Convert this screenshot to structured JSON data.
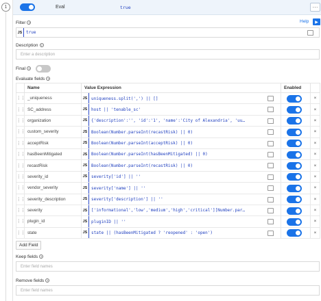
{
  "step": {
    "number": "1"
  },
  "header": {
    "rule_name": "Eval",
    "condition": "true",
    "enabled": true,
    "more_label": "···"
  },
  "filter": {
    "label": "Filter",
    "help_label": "Help",
    "lang": "JS",
    "code": "true"
  },
  "description": {
    "label": "Description",
    "placeholder": "Enter a description"
  },
  "final": {
    "label": "Final",
    "enabled": false
  },
  "evaluate": {
    "label": "Evaluate fields",
    "col_name": "Name",
    "col_expression": "Value Expression",
    "col_enabled": "Enabled",
    "rows": [
      {
        "name": "_uniqueness",
        "lang": "JS",
        "expr": "uniqueness.split(',') || []",
        "enabled": true
      },
      {
        "name": "SC_address",
        "lang": "JS",
        "expr": "host || 'tenable_sc'",
        "enabled": true
      },
      {
        "name": "organization",
        "lang": "JS",
        "expr": "{'description':'', 'id':'1', 'name':'City of Alexandria', 'uu…",
        "enabled": true
      },
      {
        "name": "custom_severity",
        "lang": "JS",
        "expr": "Boolean(Number.parseInt(recastRisk) || 0)",
        "enabled": true
      },
      {
        "name": "acceptRisk",
        "lang": "JS",
        "expr": "Boolean(Number.parseInt(acceptRisk) || 0)",
        "enabled": true
      },
      {
        "name": "hasBeenMitigated",
        "lang": "JS",
        "expr": "Boolean(Number.parseInt(hasBeenMitigated) || 0)",
        "enabled": true
      },
      {
        "name": "recastRisk",
        "lang": "JS",
        "expr": "Boolean(Number.parseInt(recastRisk) || 0)",
        "enabled": true
      },
      {
        "name": "severity_id",
        "lang": "JS",
        "expr": "severity['id'] || ''",
        "enabled": true
      },
      {
        "name": "vendor_severity",
        "lang": "JS",
        "expr": "severity['name'] || ''",
        "enabled": true
      },
      {
        "name": "severity_description",
        "lang": "JS",
        "expr": "severity['description'] || ''",
        "enabled": true
      },
      {
        "name": "severity",
        "lang": "JS",
        "expr": "['informational','low','medium','high','critical'][Number.par…",
        "enabled": true
      },
      {
        "name": "plugin_id",
        "lang": "JS",
        "expr": "pluginID || ''",
        "enabled": true
      },
      {
        "name": "state",
        "lang": "JS",
        "expr": "state || (hasBeenMitigated ? 'reopened' : 'open')",
        "enabled": true
      }
    ],
    "add_label": "Add Field"
  },
  "keep_fields": {
    "label": "Keep fields",
    "placeholder": "Enter field names"
  },
  "remove_fields": {
    "label": "Remove fields",
    "placeholder": "Enter field names"
  },
  "colors": {
    "accent": "#1a73e8",
    "code": "#1f3fbf",
    "header_bg": "#eef4fb"
  }
}
